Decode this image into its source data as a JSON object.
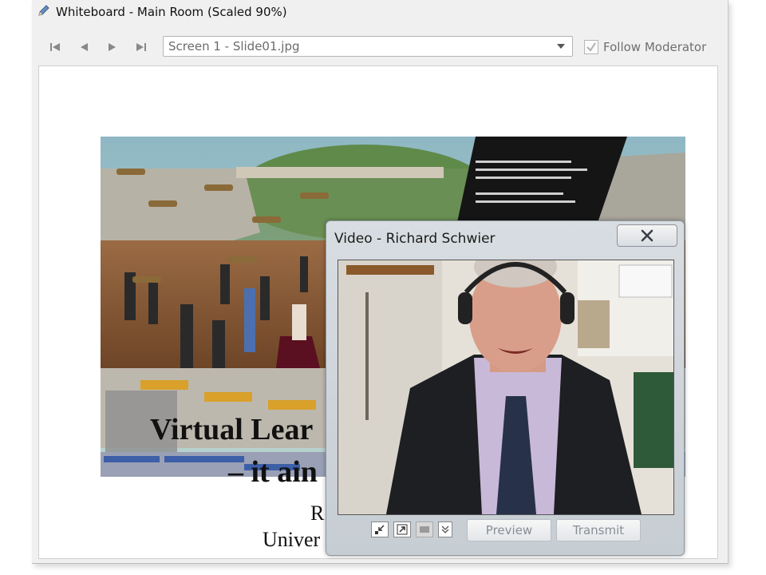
{
  "whiteboard": {
    "title": "Whiteboard - Main Room (Scaled 90%)",
    "icon": "pencil-icon",
    "nav": [
      "first-slide-icon",
      "prev-slide-icon",
      "next-slide-icon",
      "last-slide-icon"
    ],
    "screen_select": {
      "value": "Screen 1 - Slide01.jpg"
    },
    "follow_moderator": {
      "label": "Follow Moderator",
      "checked": true
    }
  },
  "slide": {
    "line1": "Virtual Lear",
    "line2": "– it ain",
    "line3": "R",
    "line4": "Univer"
  },
  "video": {
    "title": "Video - Richard Schwier",
    "close_icon": "close-icon",
    "controls": [
      "shrink-icon",
      "expand-icon",
      "camera-icon",
      "chevron-down-icon"
    ],
    "preview_label": "Preview",
    "transmit_label": "Transmit"
  },
  "colors": {
    "window_bg": "#f0f0f0",
    "video_chrome": "#cdd3d9",
    "disabled_text": "#8a8f95"
  }
}
